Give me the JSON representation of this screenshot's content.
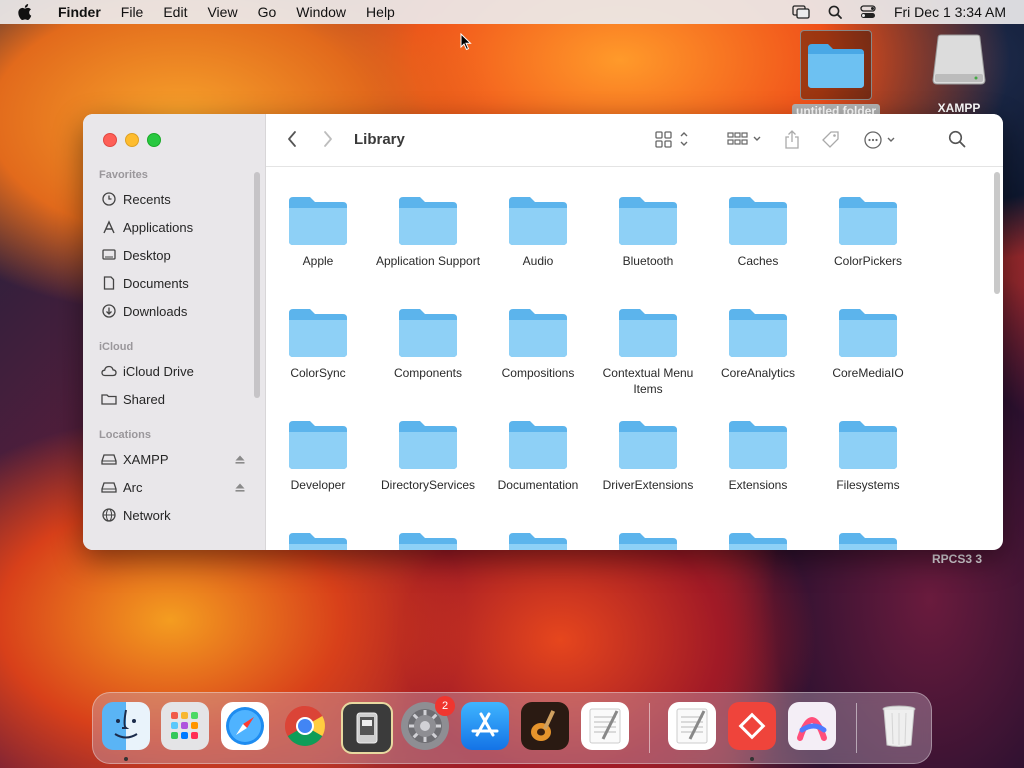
{
  "menubar": {
    "app": "Finder",
    "menus": [
      "File",
      "Edit",
      "View",
      "Go",
      "Window",
      "Help"
    ],
    "clock": "Fri Dec 1  3:34 AM"
  },
  "desktop": {
    "folder_label": "untitled folder",
    "drive_label": "XAMPP",
    "rpcs_label": "RPCS3 3"
  },
  "window": {
    "title": "Library",
    "sidebar": {
      "favorites_header": "Favorites",
      "favorites": [
        {
          "label": "Recents",
          "icon": "clock-icon"
        },
        {
          "label": "Applications",
          "icon": "applications-icon"
        },
        {
          "label": "Desktop",
          "icon": "desktop-icon"
        },
        {
          "label": "Documents",
          "icon": "document-icon"
        },
        {
          "label": "Downloads",
          "icon": "download-icon"
        }
      ],
      "icloud_header": "iCloud",
      "icloud": [
        {
          "label": "iCloud Drive",
          "icon": "cloud-icon"
        },
        {
          "label": "Shared",
          "icon": "shared-folder-icon"
        }
      ],
      "locations_header": "Locations",
      "locations": [
        {
          "label": "XAMPP",
          "icon": "drive-icon",
          "eject": true
        },
        {
          "label": "Arc",
          "icon": "drive-icon",
          "eject": true
        },
        {
          "label": "Network",
          "icon": "globe-icon"
        }
      ]
    },
    "items": [
      "Apple",
      "Application Support",
      "Audio",
      "Bluetooth",
      "Caches",
      "ColorPickers",
      "ColorSync",
      "Components",
      "Compositions",
      "Contextual Menu Items",
      "CoreAnalytics",
      "CoreMediaIO",
      "Developer",
      "DirectoryServices",
      "Documentation",
      "DriverExtensions",
      "Extensions",
      "Filesystems"
    ]
  },
  "dock": {
    "apps": [
      "Finder",
      "Launchpad",
      "Safari",
      "Chrome",
      "Simulator",
      "System Settings",
      "App Store",
      "GarageBand",
      "TextEdit",
      "TextEdit 2",
      "AnyDesk",
      "Arc",
      "Trash"
    ],
    "settings_badge": "2"
  },
  "colors": {
    "folder": "#5cb4ec",
    "folder_light": "#8ed0f6",
    "accent": "#0a84ff"
  }
}
